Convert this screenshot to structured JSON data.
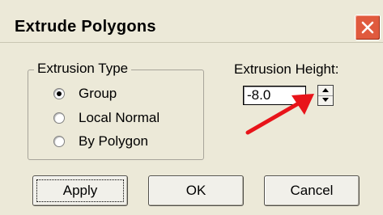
{
  "window": {
    "title": "Extrude Polygons",
    "close_icon": "close-icon"
  },
  "extrusion_type": {
    "legend": "Extrusion Type",
    "options": [
      {
        "label": "Group",
        "selected": true
      },
      {
        "label": "Local Normal",
        "selected": false
      },
      {
        "label": "By Polygon",
        "selected": false
      }
    ]
  },
  "extrusion_height": {
    "label": "Extrusion Height:",
    "value": "-8.0"
  },
  "buttons": {
    "apply": "Apply",
    "ok": "OK",
    "cancel": "Cancel"
  },
  "colors": {
    "dialog_bg": "#ECE9D8",
    "close_button": "#E05A3E",
    "annotation_arrow": "#E8141A"
  }
}
